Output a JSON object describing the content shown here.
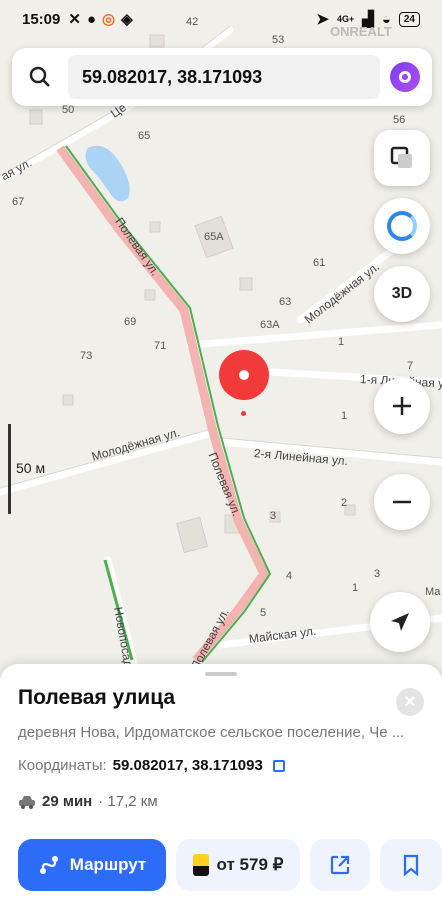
{
  "status_bar": {
    "time": "15:09",
    "network": "4G+",
    "battery": "24"
  },
  "search": {
    "value": "59.082017, 38.171093"
  },
  "map": {
    "house_numbers": [
      "42",
      "53",
      "50",
      "65",
      "56",
      "67",
      "65А",
      "61",
      "63",
      "69",
      "71",
      "63А",
      "1",
      "73",
      "7",
      "1",
      "2",
      "3",
      "4",
      "1",
      "3",
      "5",
      "Ма"
    ],
    "streets": {
      "poleva_upper": "Полевая ул.",
      "poleva_lower": "Полевая ул.",
      "poleva_bottom": "Полевая ул.",
      "molodezhnaya_top": "Молодёжная ул.",
      "molodezhnaya_left": "Молодёжная ул.",
      "lineynaya1": "1-я Линейная ул.",
      "lineynaya2": "2-я Линейная ул.",
      "mayskaya": "Майская ул.",
      "novoposad": "Новопосад",
      "left_street": "ая ул.",
      "top_street": "Це"
    },
    "scale": "50 м",
    "controls": {
      "three_d": "3D"
    },
    "watermark": "ONREALT"
  },
  "card": {
    "title": "Полевая улица",
    "address": "деревня Нова, Ирдоматское сельское поселение, Че ...",
    "coords_label": "Координаты:",
    "coords_value": "59.082017, 38.171093",
    "travel_time": "29 мин",
    "distance": "· 17,2 км",
    "route_label": "Маршрут",
    "taxi_label": "от 579 ₽"
  },
  "colors": {
    "accent": "#2d6cf6",
    "pin": "#f33a3a",
    "route_highlight": "#f3b3b0"
  }
}
